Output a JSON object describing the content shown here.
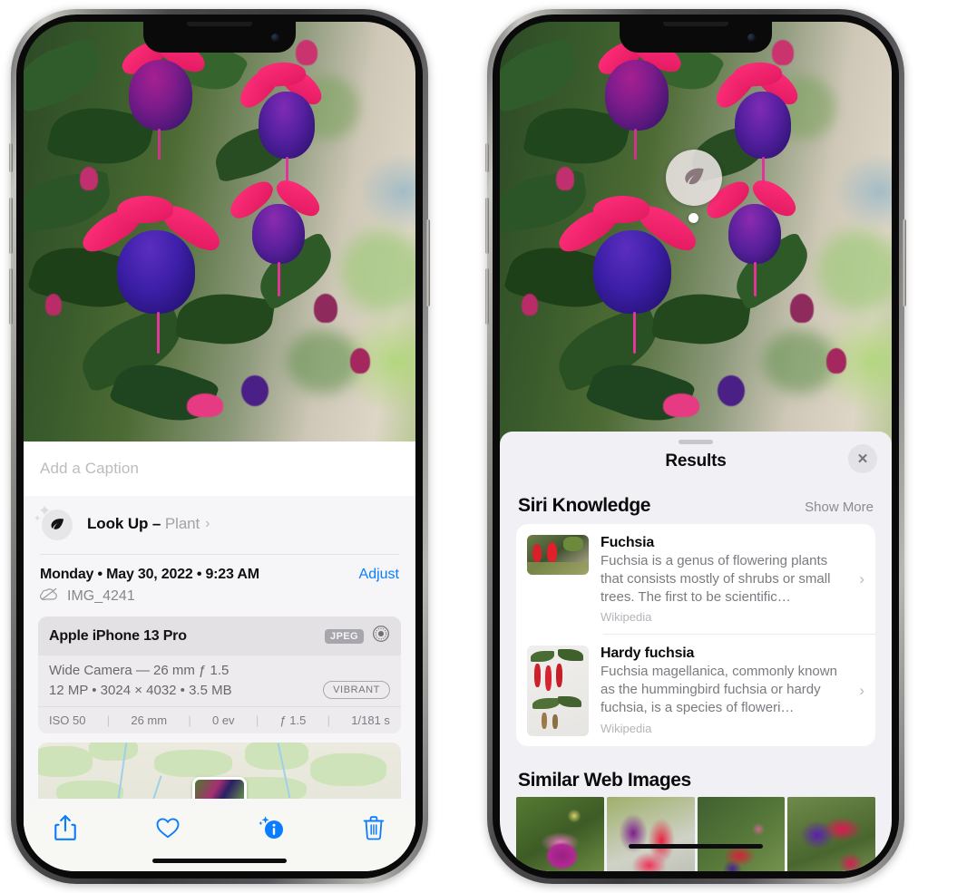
{
  "left_phone": {
    "caption": {
      "placeholder": "Add a Caption",
      "value": ""
    },
    "look_up": {
      "icon": "leaf-icon",
      "label": "Look Up",
      "dash": " – ",
      "subject": "Plant",
      "chevron": "›"
    },
    "date_row": {
      "date_text": "Monday • May 30, 2022 • 9:23 AM",
      "adjust_label": "Adjust"
    },
    "file_row": {
      "icon": "cloud-slash-icon",
      "file_name": "IMG_4241"
    },
    "metadata": {
      "device": "Apple iPhone 13 Pro",
      "format_badge": "JPEG",
      "raw_icon": "aperture-icon",
      "lens_line": "Wide Camera — 26 mm ƒ 1.5",
      "spec_line": "12 MP • 3024 × 4032 • 3.5 MB",
      "style_badge": "VIBRANT",
      "exif": [
        {
          "label": "ISO 50"
        },
        {
          "label": "26 mm"
        },
        {
          "label": "0 ev"
        },
        {
          "label": "ƒ 1.5"
        },
        {
          "label": "1/181 s"
        }
      ],
      "separator": "|"
    },
    "toolbar": [
      {
        "name": "share-button",
        "icon": "share-icon"
      },
      {
        "name": "favorite-button",
        "icon": "heart-icon"
      },
      {
        "name": "info-button",
        "icon": "info-sparkle-icon"
      },
      {
        "name": "delete-button",
        "icon": "trash-icon"
      }
    ]
  },
  "right_phone": {
    "visual_lookup_badge": {
      "icon": "leaf-icon"
    },
    "sheet": {
      "title": "Results",
      "close_label": "✕"
    },
    "siri_knowledge": {
      "heading": "Siri Knowledge",
      "show_more": "Show More",
      "items": [
        {
          "title": "Fuchsia",
          "description": "Fuchsia is a genus of flowering plants that consists mostly of shrubs or small trees. The first to be scientific…",
          "source": "Wikipedia",
          "chevron": "›"
        },
        {
          "title": "Hardy fuchsia",
          "description": "Fuchsia magellanica, commonly known as the hummingbird fuchsia or hardy fuchsia, is a species of floweri…",
          "source": "Wikipedia",
          "chevron": "›"
        }
      ]
    },
    "similar_web_images": {
      "heading": "Similar Web Images",
      "count": 4
    }
  },
  "colors": {
    "accent_blue": "#0a7cff",
    "sheet_bg": "#f1f0f5",
    "card_bg": "#ffffff",
    "muted_text": "#7a7a80",
    "toolbar_bg": "#f7f8f3"
  }
}
